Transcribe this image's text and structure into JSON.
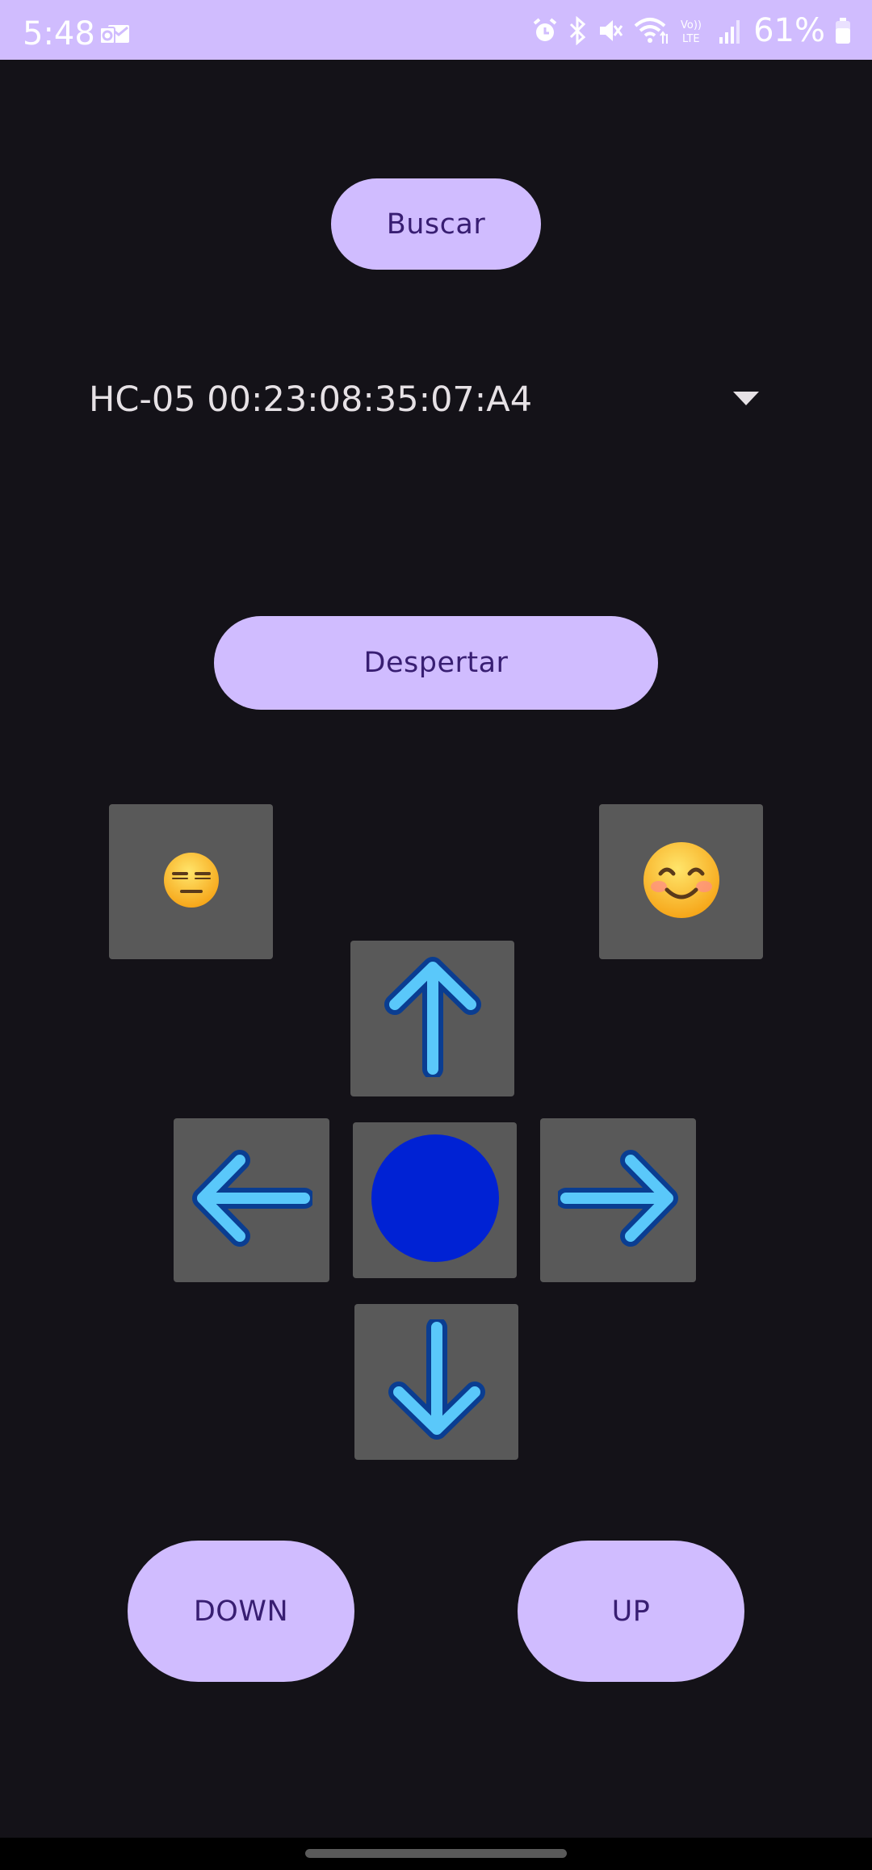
{
  "status_bar": {
    "time": "5:48",
    "battery_percent": "61%",
    "icons": [
      "outlook-icon",
      "alarm-icon",
      "bluetooth-icon",
      "mute-icon",
      "wifi-icon",
      "volte-icon",
      "signal-icon",
      "battery-icon"
    ]
  },
  "buttons": {
    "search_label": "Buscar",
    "wake_label": "Despertar",
    "down_label": "DOWN",
    "up_label": "UP"
  },
  "device_spinner": {
    "selected": "HC-05 00:23:08:35:07:A4"
  },
  "emoji_buttons": {
    "neutral": "neutral-face-icon",
    "smile": "smiling-face-icon"
  },
  "dpad": {
    "up": "arrow-up-icon",
    "left": "arrow-left-icon",
    "center": "blue-circle-icon",
    "right": "arrow-right-icon",
    "down": "arrow-down-icon"
  },
  "colors": {
    "background": "#141218",
    "accent": "#d0bcff",
    "on_accent": "#381e72",
    "tile": "#595959",
    "arrow_fill": "#5ac8fa",
    "arrow_stroke": "#0a3d91",
    "center_circle": "#0022d4"
  }
}
